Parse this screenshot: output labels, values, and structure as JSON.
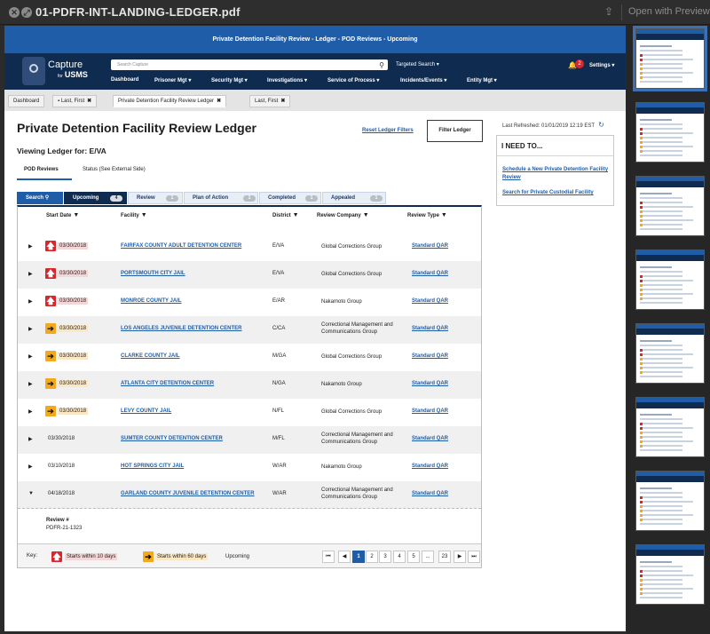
{
  "window": {
    "title": "01-PDFR-INT-LANDING-LEDGER.pdf",
    "open_with": "Open with Preview",
    "close_glyph": "✕",
    "fullscreen_glyph": "⤢",
    "share_glyph": "⇪"
  },
  "banner": "Private Detention Facility Review - Ledger - POD Reviews - Upcoming",
  "brand": {
    "name": "Capture",
    "for": "for",
    "sub": "USMS"
  },
  "search": {
    "placeholder": "Search Capture",
    "icon_glyph": "⚲"
  },
  "targeted_search": "Targeted Search ▾",
  "notifications": {
    "glyph": "🔔",
    "count": "2"
  },
  "settings": "Settings ▾",
  "menu": [
    "Dashboard",
    "Prisoner Mgt ▾",
    "Security Mgt ▾",
    "Investigations ▾",
    "Service of Process ▾",
    "Incidents/Events ▾",
    "Entity Mgt ▾"
  ],
  "tabs": [
    {
      "label": "Dashboard",
      "glyph": ""
    },
    {
      "label": "Last, First",
      "glyph": "▪"
    },
    {
      "label": "Private Detention Facility Review Ledger",
      "glyph": ""
    },
    {
      "label": "Last, First",
      "glyph": ""
    }
  ],
  "tab_close": "✖",
  "page_title": "Private Detention Facility Review Ledger",
  "viewing": "Viewing Ledger for: E/VA",
  "reset_filters": "Reset Ledger Filters",
  "filter_button": "Filter Ledger",
  "subtabs": [
    "POD Reviews",
    "Status (See External Side)"
  ],
  "status_tabs": [
    {
      "label": "Search",
      "count": "",
      "icon": "search-icon"
    },
    {
      "label": "Upcoming",
      "count": "4"
    },
    {
      "label": "Review",
      "count": "1"
    },
    {
      "label": "Plan of Action",
      "count": "1"
    },
    {
      "label": "Completed",
      "count": "1"
    },
    {
      "label": "Appealed",
      "count": "1"
    }
  ],
  "search_tab_glyph": "⚲",
  "filter_glyph": "▼",
  "columns": [
    "Start Date",
    "Facility",
    "District",
    "Review Company",
    "Review Type"
  ],
  "rows": [
    {
      "flag": "red",
      "date": "03/30/2018",
      "facility": "FAIRFAX COUNTY ADULT DETENTION CENTER",
      "district": "E/VA",
      "company": "Global Corrections Group",
      "type": "Standard QAR",
      "expanded": false
    },
    {
      "flag": "red",
      "date": "03/30/2018",
      "facility": "PORTSMOUTH CITY JAIL",
      "district": "E/VA",
      "company": "Global Corrections Group",
      "type": "Standard QAR",
      "expanded": false
    },
    {
      "flag": "red",
      "date": "03/30/2018",
      "facility": "MONROE COUNTY JAIL",
      "district": "E/AR",
      "company": "Nakamoto Group",
      "type": "Standard QAR",
      "expanded": false
    },
    {
      "flag": "amber",
      "date": "03/30/2018",
      "facility": "LOS ANGELES JUVENILE DETENTION CENTER",
      "district": "C/CA",
      "company": "Correctional Management and Communications Group",
      "type": "Standard QAR",
      "expanded": false
    },
    {
      "flag": "amber",
      "date": "03/30/2018",
      "facility": "CLARKE COUNTY JAIL",
      "district": "M/GA",
      "company": "Global Corrections Group",
      "type": "Standard QAR",
      "expanded": false
    },
    {
      "flag": "amber",
      "date": "03/30/2018",
      "facility": "ATLANTA CITY DETENTION CENTER",
      "district": "N/GA",
      "company": "Nakamoto Group",
      "type": "Standard QAR",
      "expanded": false
    },
    {
      "flag": "amber",
      "date": "03/30/2018",
      "facility": "LEVY COUNTY JAIL",
      "district": "N/FL",
      "company": "Global Corrections Group",
      "type": "Standard QAR",
      "expanded": false
    },
    {
      "flag": "",
      "date": "03/30/2018",
      "facility": "SUMTER COUNTY DETENTION CENTER",
      "district": "M/FL",
      "company": "Correctional Management and Communications Group",
      "type": "Standard QAR",
      "expanded": false
    },
    {
      "flag": "",
      "date": "03/10/2018",
      "facility": "HOT SPRINGS CITY JAIL",
      "district": "W/AR",
      "company": "Nakamoto Group",
      "type": "Standard QAR",
      "expanded": false
    },
    {
      "flag": "",
      "date": "04/18/2018",
      "facility": "GARLAND COUNTY JUVENILE DETENTION CENTER",
      "district": "W/AR",
      "company": "Correctional Management and Communications Group",
      "type": "Standard QAR",
      "expanded": true
    }
  ],
  "review_detail": {
    "label": "Review #",
    "value": "PDFR-21-1323"
  },
  "key": {
    "label": "Key:",
    "red": "Starts within 10 days",
    "amber": "Starts within 60 days",
    "upcoming": "Upcoming"
  },
  "pagination": [
    "⏮",
    "◀",
    "1",
    "2",
    "3",
    "4",
    "5",
    "...",
    "23",
    "▶",
    "⏭"
  ],
  "pagination_current": "1",
  "last_refreshed": "Last Refreshed: 01/01/2019 12:19 EST",
  "refresh_glyph": "↻",
  "ineed": {
    "title": "I NEED TO...",
    "links": [
      "Schedule a New Private Detention Facility Review",
      "Search for Private Custodial Facility"
    ]
  },
  "icons": {
    "up_arrow": "🡅",
    "right_arrow": "➔",
    "expand": "▶",
    "collapse": "▼"
  },
  "colors": {
    "banner": "#1f5da9",
    "nav": "#0f2b4f",
    "link": "#1f5da9",
    "red_flag": "#d9272e",
    "amber_flag": "#f4a81d"
  }
}
